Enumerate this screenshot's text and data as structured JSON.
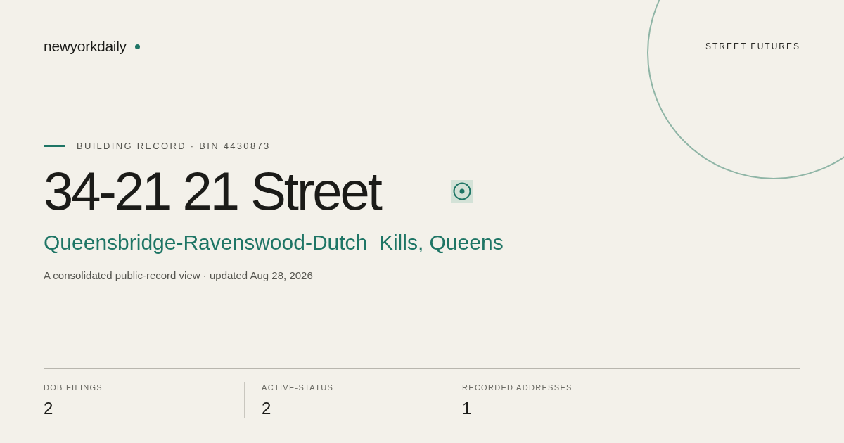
{
  "brand": {
    "name": "newyorkdaily"
  },
  "section_label": "STREET FUTURES",
  "eyebrow": "BUILDING RECORD · BIN 4430873",
  "title": "34-21 21 Street",
  "subtitle": "Queensbridge-Ravenswood-Dutch  Kills, Queens",
  "description": "A consolidated public-record view · updated Aug 28, 2026",
  "stats": [
    {
      "label": "DOB FILINGS",
      "value": "2"
    },
    {
      "label": "ACTIVE-STATUS",
      "value": "2"
    },
    {
      "label": "RECORDED ADDRESSES",
      "value": "1"
    }
  ]
}
